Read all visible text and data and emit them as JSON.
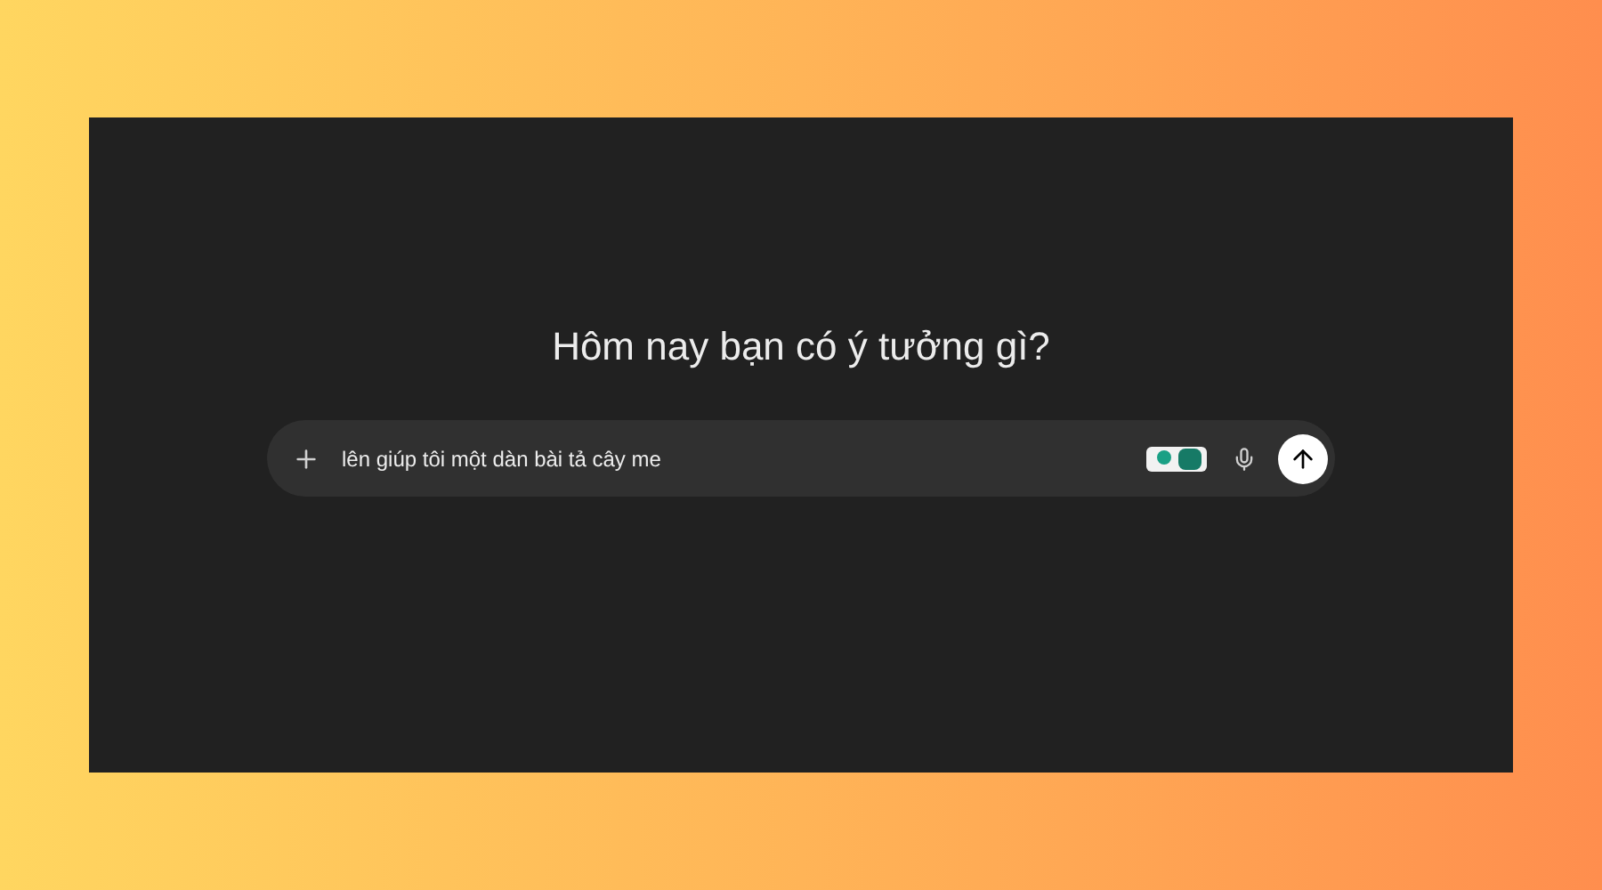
{
  "heading": "Hôm nay bạn có ý tưởng gì?",
  "composer": {
    "value": "lên giúp tôi một dàn bài tả cây me"
  }
}
